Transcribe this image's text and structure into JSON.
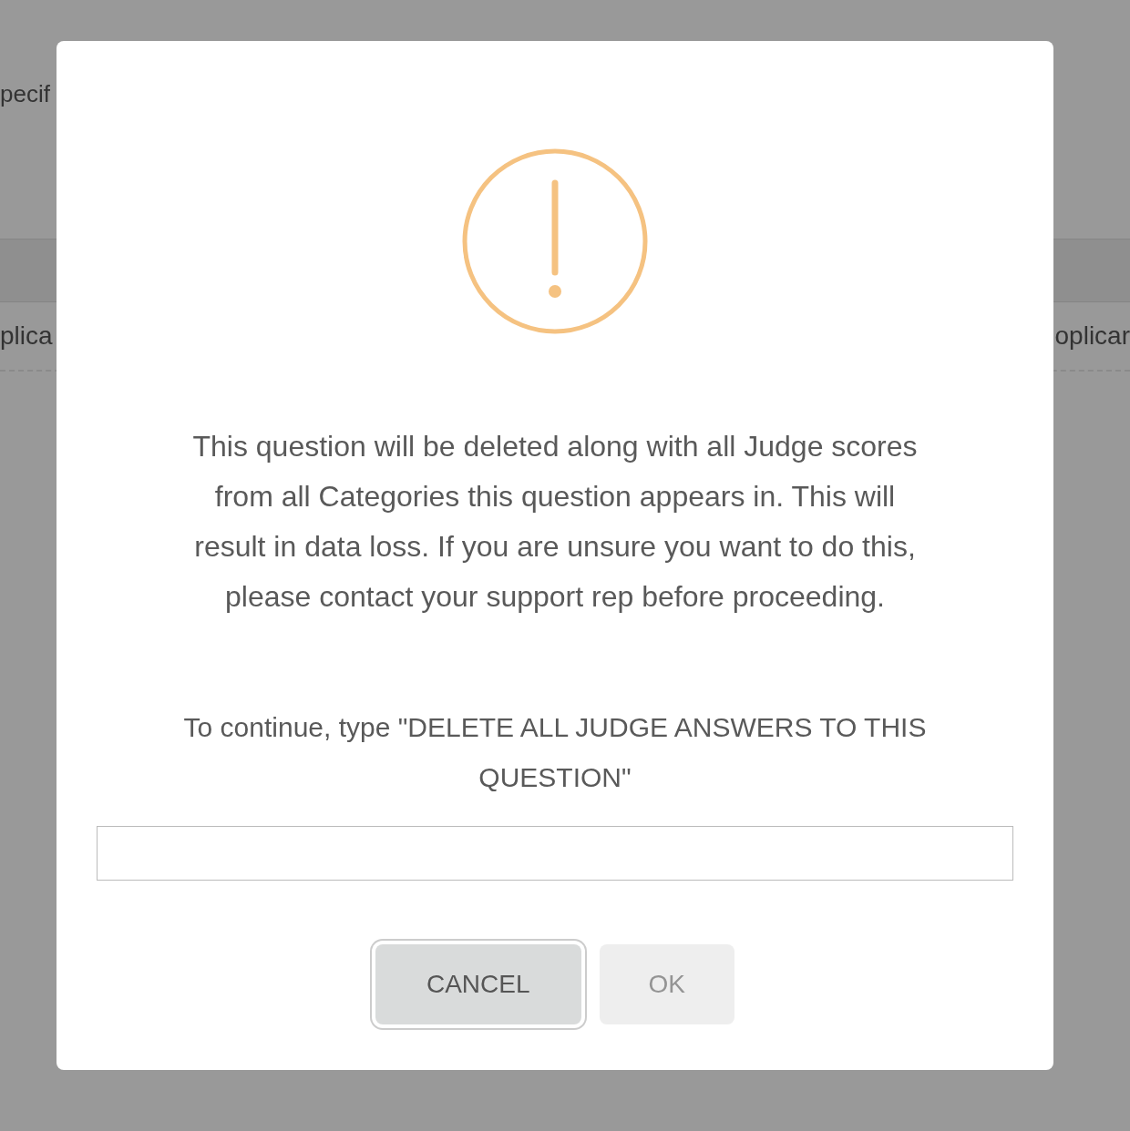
{
  "background_page": {
    "intro_text": "pecif",
    "table_rows": [
      {
        "column_1": "plica",
        "column_2": "oplicar"
      }
    ]
  },
  "dialog": {
    "message": "This question will be deleted along with all Judge scores from all Categories this question appears in. This will result in data loss. If you are unsure you want to do this, please contact your support rep before proceeding.",
    "prompt": "To continue, type \"DELETE ALL JUDGE ANSWERS TO THIS QUESTION\"",
    "buttons": [
      {
        "label": "CANCEL",
        "disabled": false,
        "focused": true
      },
      {
        "label": "OK",
        "disabled": true,
        "focused": false
      }
    ]
  }
}
